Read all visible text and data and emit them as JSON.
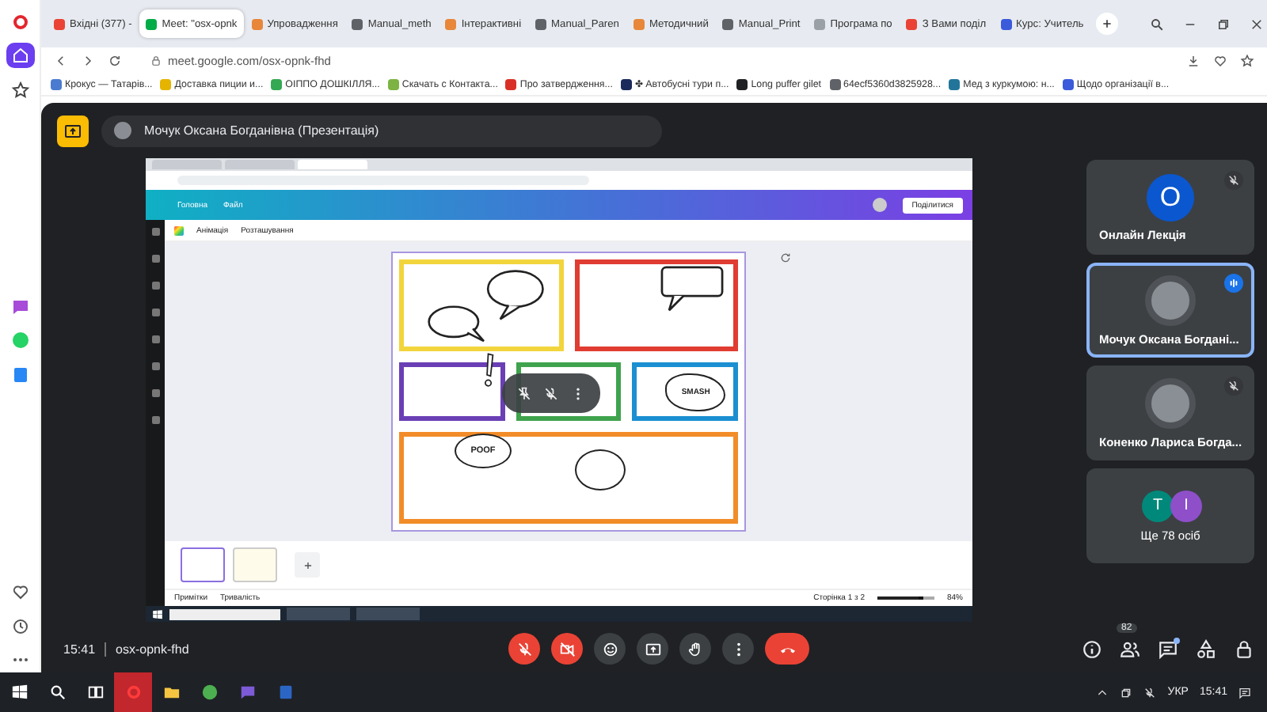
{
  "sidebar": {
    "items": [
      {
        "kind": "opera",
        "selected": false
      },
      {
        "kind": "home",
        "selected": true
      },
      {
        "kind": "star",
        "selected": false
      },
      {
        "kind": "messenger",
        "selected": false
      },
      {
        "kind": "whatsapp",
        "selected": false
      },
      {
        "kind": "vk",
        "selected": false
      },
      {
        "kind": "heart",
        "selected": false
      },
      {
        "kind": "clock",
        "selected": false
      },
      {
        "kind": "more",
        "selected": false
      }
    ]
  },
  "browser": {
    "tabs": [
      {
        "title": "Вхідні (377) -",
        "color": "#ea4335",
        "selected": false
      },
      {
        "title": "Meet: \"osx-opnk",
        "color": "#00ac47",
        "selected": true
      },
      {
        "title": "Упровадження",
        "color": "#e8863a",
        "selected": false
      },
      {
        "title": "Manual_meth",
        "color": "#5f6368",
        "selected": false
      },
      {
        "title": "Інтерактивні",
        "color": "#e8863a",
        "selected": false
      },
      {
        "title": "Manual_Paren",
        "color": "#5f6368",
        "selected": false
      },
      {
        "title": "Методичний",
        "color": "#e8863a",
        "selected": false
      },
      {
        "title": "Manual_Print",
        "color": "#5f6368",
        "selected": false
      },
      {
        "title": "Програма по",
        "color": "#9aa0a6",
        "selected": false
      },
      {
        "title": "З Вами поділ",
        "color": "#ea4335",
        "selected": false
      },
      {
        "title": "Курс: Учитель",
        "color": "#3b5bdb",
        "selected": false
      }
    ],
    "address": "meet.google.com/osx-opnk-fhd",
    "bookmarks": [
      {
        "title": "Крокус — Татарів...",
        "color": "#4a7bd0"
      },
      {
        "title": "Доставка пиции и...",
        "color": "#e5b400"
      },
      {
        "title": "ОІППО ДОШКІЛЛЯ...",
        "color": "#34a853"
      },
      {
        "title": "Скачать с Контакта...",
        "color": "#7cb342"
      },
      {
        "title": "Про затвердження...",
        "color": "#d93025"
      },
      {
        "title": "✤ Автобусні тури п...",
        "color": "#1a2a5a"
      },
      {
        "title": "Long puffer gilet",
        "color": "#202124"
      },
      {
        "title": "64ecf5360d3825928...",
        "color": "#5f6368"
      },
      {
        "title": "Мед з куркумою: н...",
        "color": "#21759b"
      },
      {
        "title": "Щодо організації в...",
        "color": "#3b5bdb"
      }
    ]
  },
  "meet": {
    "presenter": "Мочук Оксана Богданівна (Презентація)",
    "shared_screen": {
      "tabs": [
        {
          "selected": false
        },
        {
          "selected": false
        },
        {
          "selected": true
        }
      ],
      "menu": [
        "Головна",
        "Файл"
      ],
      "share_button": "Поділитися",
      "toolbar": [
        "Анімація",
        "Розташування"
      ],
      "rows": [
        [
          {
            "color": "#f2d53c",
            "kind": "bubbles"
          },
          {
            "color": "#e03c31",
            "kind": "box-bubble"
          }
        ],
        [
          {
            "color": "#6a3fb5",
            "kind": "exclaim"
          },
          {
            "color": "#3fa34d",
            "kind": "plain"
          },
          {
            "color": "#1b8fd2",
            "kind": "smash",
            "text": "SMASH"
          }
        ],
        [
          {
            "color": "#f28c28",
            "kind": "poof",
            "text": "POOF"
          }
        ]
      ],
      "page_thumbs": [
        {
          "selected": true
        },
        {
          "selected": false
        }
      ],
      "notes": "Примітки",
      "duration": "Тривалість",
      "page_label": "Сторінка 1 з 2",
      "zoom_slider": {
        "level": 0.8
      },
      "zoom": "84%"
    },
    "tiles": [
      {
        "kind": "letter",
        "letter": "О",
        "color": "#0b57d0",
        "name": "Онлайн Лекція",
        "muted": true,
        "speaking": false,
        "selected": false
      },
      {
        "kind": "photo",
        "name": "Мочук Оксана Богдані...",
        "muted": false,
        "speaking": true,
        "selected": true
      },
      {
        "kind": "photo",
        "name": "Коненко Лариса Богда...",
        "muted": true,
        "speaking": false,
        "selected": false
      },
      {
        "kind": "more",
        "avatars": [
          {
            "letter": "T",
            "color": "#00897b"
          },
          {
            "letter": "I",
            "color": "#8e4fc9"
          }
        ],
        "name": "Ще 78 осіб",
        "selected": false
      }
    ],
    "time": "15:41",
    "meeting_code": "osx-opnk-fhd",
    "controls": [
      {
        "kind": "mic",
        "on": false
      },
      {
        "kind": "camera",
        "on": false
      },
      {
        "kind": "reactions"
      },
      {
        "kind": "present"
      },
      {
        "kind": "hand"
      },
      {
        "kind": "more"
      },
      {
        "kind": "leave"
      }
    ],
    "side_buttons": [
      {
        "kind": "info",
        "unread": false
      },
      {
        "kind": "people",
        "badge": "82",
        "unread": false
      },
      {
        "kind": "chat",
        "unread": true
      },
      {
        "kind": "activities",
        "unread": false
      },
      {
        "kind": "lock",
        "unread": false
      }
    ]
  },
  "taskbar": {
    "apps": [
      {
        "kind": "start",
        "active": false
      },
      {
        "kind": "search",
        "active": false
      },
      {
        "kind": "taskview",
        "active": false
      },
      {
        "kind": "opera",
        "active": true
      },
      {
        "kind": "folder",
        "active": false
      },
      {
        "kind": "chrome",
        "active": false
      },
      {
        "kind": "viber",
        "active": false
      },
      {
        "kind": "word",
        "active": false
      }
    ],
    "language": "УКР",
    "time": "15:41"
  }
}
